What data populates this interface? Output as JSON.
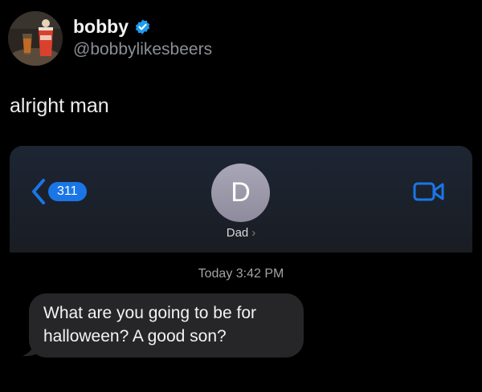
{
  "tweet": {
    "display_name": "bobby",
    "handle": "@bobbylikesbeers",
    "text": "alright man",
    "verified_icon": "verified-badge-icon",
    "accent_color": "#1d9bf0"
  },
  "imessage": {
    "unread_count": "311",
    "contact_initial": "D",
    "contact_name": "Dad",
    "timestamp_day": "Today",
    "timestamp_time": "3:42 PM",
    "messages": [
      {
        "direction": "incoming",
        "text": "What are you going to be for halloween? A good son?"
      }
    ],
    "accent_color": "#1a76e6",
    "video_icon": "video-camera-icon",
    "back_icon": "chevron-left-icon"
  }
}
